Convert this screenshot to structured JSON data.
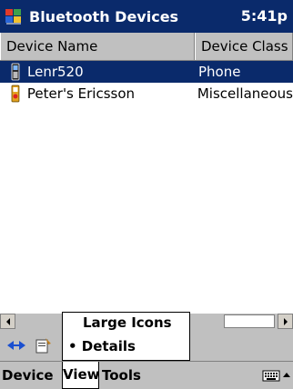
{
  "window": {
    "title": "Bluetooth Devices",
    "clock": "5:41p"
  },
  "columns": {
    "name": "Device Name",
    "class": "Device Class"
  },
  "devices": [
    {
      "name": "Lenr520",
      "class": "Phone"
    },
    {
      "name": "Peter's Ericsson",
      "class": "Miscellaneous"
    }
  ],
  "view_menu": {
    "items": [
      {
        "label": "Large Icons"
      },
      {
        "label": "• Details"
      }
    ]
  },
  "menubar": {
    "device": "Device",
    "view": "View",
    "tools": "Tools"
  },
  "colors": {
    "titlebar": "#0a2a6b",
    "selection": "#0a2a6b",
    "chrome": "#c0c0c0"
  }
}
